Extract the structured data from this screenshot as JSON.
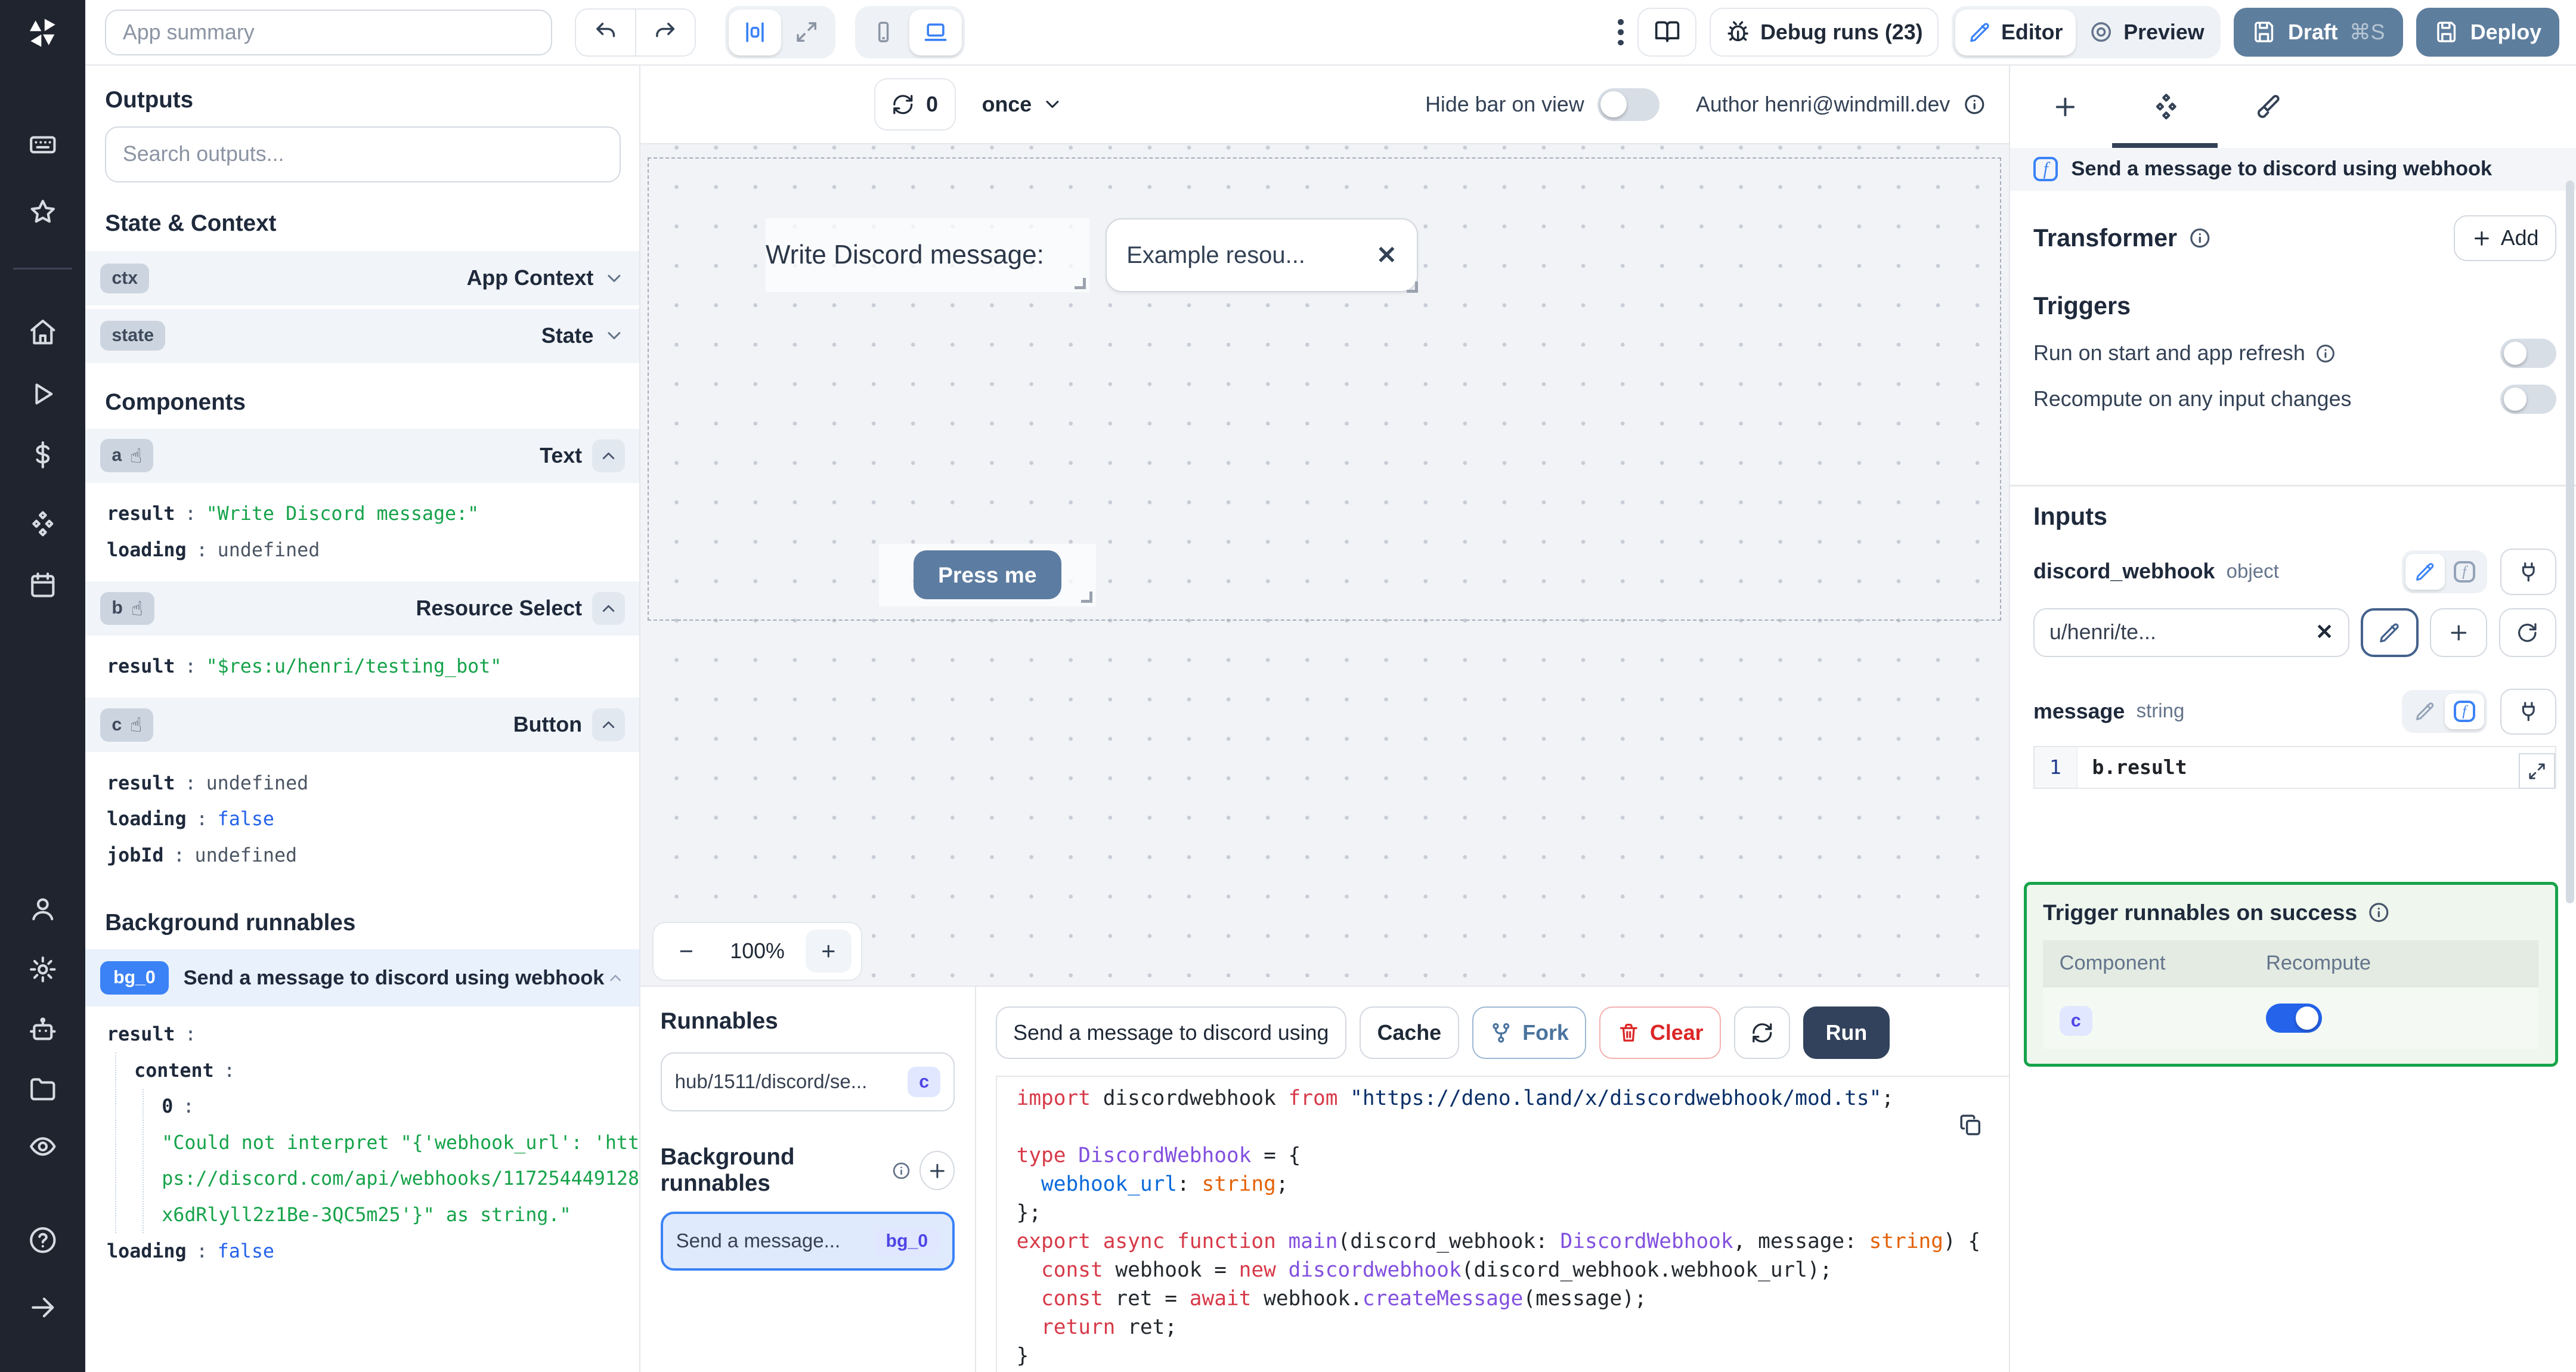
{
  "colors": {
    "accent_blue": "#3b82f6",
    "toggle_on": "#2563eb",
    "primary_button": "#5e7e9e",
    "run_button": "#32425c",
    "success_border": "#16a34a",
    "value_green": "#16a34a",
    "value_blue": "#2563eb",
    "rail_bg": "#1f242e"
  },
  "rail": {
    "icons_top": [
      "keyboard",
      "star",
      "home",
      "play",
      "dollar",
      "hub",
      "calendar"
    ],
    "icons_bottom": [
      "user",
      "gear",
      "robot",
      "folder",
      "eye",
      "help-circle",
      "arrow-right"
    ]
  },
  "topbar": {
    "app_summary_placeholder": "App summary",
    "debug_runs_label": "Debug runs (23)",
    "editor_label": "Editor",
    "preview_label": "Preview",
    "draft_label": "Draft",
    "draft_shortcut": "⌘S",
    "deploy_label": "Deploy"
  },
  "canvas_toolbar": {
    "refresh_count": "0",
    "schedule_mode": "once",
    "hide_bar_label": "Hide bar on view",
    "author_label": "Author henri@windmill.dev"
  },
  "canvas": {
    "text_component": "Write Discord message:",
    "select_value": "Example resou...",
    "button_label": "Press me",
    "zoom_out": "−",
    "zoom_level": "100%",
    "zoom_in": "+"
  },
  "outputs": {
    "title": "Outputs",
    "search_placeholder": "Search outputs...",
    "state_context_title": "State & Context",
    "ctx": {
      "badge": "ctx",
      "label": "App Context"
    },
    "state": {
      "badge": "state",
      "label": "State"
    },
    "components_title": "Components",
    "comp_a": {
      "badge": "a",
      "type": "Text",
      "rows": [
        {
          "k": "result",
          "v": "\"Write Discord message:\"",
          "c": "v-green"
        },
        {
          "k": "loading",
          "v": "undefined",
          "c": "v-gray"
        }
      ]
    },
    "comp_b": {
      "badge": "b",
      "type": "Resource Select",
      "rows": [
        {
          "k": "result",
          "v": "\"$res:u/henri/testing_bot\"",
          "c": "v-green"
        }
      ]
    },
    "comp_c": {
      "badge": "c",
      "type": "Button",
      "rows": [
        {
          "k": "result",
          "v": "undefined",
          "c": "v-gray"
        },
        {
          "k": "loading",
          "v": "false",
          "c": "v-blue"
        },
        {
          "k": "jobId",
          "v": "undefined",
          "c": "v-gray"
        }
      ]
    },
    "background_title": "Background runnables",
    "bg": {
      "badge": "bg_0",
      "title": "Send a message to discord using webhook",
      "k_result": "result",
      "k_content": "content",
      "k_zero": "0",
      "value": "\"Could not interpret \"{'webhook_url': 'https://discord.com/api/webhooks/117254449128x6dRlyll2z1Be-3QC5m25'}\" as string.\"",
      "k_loading": "loading",
      "v_loading": "false"
    }
  },
  "runnables": {
    "title": "Runnables",
    "item": {
      "label": "hub/1511/discord/se...",
      "badge": "c"
    },
    "background_title": "Background runnables",
    "selected": {
      "label": "Send a message...",
      "badge": "bg_0"
    }
  },
  "editor": {
    "tab_title": "Send a message to discord using",
    "cache_label": "Cache",
    "fork_label": "Fork",
    "clear_label": "Clear",
    "run_label": "Run",
    "code": [
      [
        {
          "t": "import ",
          "c": "tk-kw"
        },
        {
          "t": "discordwebhook ",
          "c": "tk-id"
        },
        {
          "t": "from ",
          "c": "tk-kw"
        },
        {
          "t": "\"https://deno.land/x/discordwebhook/mod.ts\"",
          "c": "tk-str"
        },
        {
          "t": ";",
          "c": "tk-pn"
        }
      ],
      [],
      [
        {
          "t": "type ",
          "c": "tk-kw"
        },
        {
          "t": "DiscordWebhook",
          "c": "tk-ty"
        },
        {
          "t": " = {",
          "c": "tk-pn"
        }
      ],
      [
        {
          "t": "  webhook_url",
          "c": "tk-pr"
        },
        {
          "t": ": ",
          "c": "tk-pn"
        },
        {
          "t": "string",
          "c": "tk-or"
        },
        {
          "t": ";",
          "c": "tk-pn"
        }
      ],
      [
        {
          "t": "};",
          "c": "tk-pn"
        }
      ],
      [
        {
          "t": "export ",
          "c": "tk-kw"
        },
        {
          "t": "async ",
          "c": "tk-kw"
        },
        {
          "t": "function ",
          "c": "tk-kw"
        },
        {
          "t": "main",
          "c": "tk-fn"
        },
        {
          "t": "(",
          "c": "tk-pn"
        },
        {
          "t": "discord_webhook",
          "c": "tk-id"
        },
        {
          "t": ": ",
          "c": "tk-pn"
        },
        {
          "t": "DiscordWebhook",
          "c": "tk-ty"
        },
        {
          "t": ", ",
          "c": "tk-pn"
        },
        {
          "t": "message",
          "c": "tk-id"
        },
        {
          "t": ": ",
          "c": "tk-pn"
        },
        {
          "t": "string",
          "c": "tk-or"
        },
        {
          "t": ") {",
          "c": "tk-pn"
        }
      ],
      [
        {
          "t": "  const ",
          "c": "tk-kw"
        },
        {
          "t": "webhook",
          "c": "tk-id"
        },
        {
          "t": " = ",
          "c": "tk-pn"
        },
        {
          "t": "new ",
          "c": "tk-kw"
        },
        {
          "t": "discordwebhook",
          "c": "tk-fn"
        },
        {
          "t": "(",
          "c": "tk-pn"
        },
        {
          "t": "discord_webhook",
          "c": "tk-id"
        },
        {
          "t": ".",
          "c": "tk-pn"
        },
        {
          "t": "webhook_url",
          "c": "tk-id"
        },
        {
          "t": ");",
          "c": "tk-pn"
        }
      ],
      [
        {
          "t": "  const ",
          "c": "tk-kw"
        },
        {
          "t": "ret",
          "c": "tk-id"
        },
        {
          "t": " = ",
          "c": "tk-pn"
        },
        {
          "t": "await ",
          "c": "tk-kw"
        },
        {
          "t": "webhook",
          "c": "tk-id"
        },
        {
          "t": ".",
          "c": "tk-pn"
        },
        {
          "t": "createMessage",
          "c": "tk-fn"
        },
        {
          "t": "(",
          "c": "tk-pn"
        },
        {
          "t": "message",
          "c": "tk-id"
        },
        {
          "t": ");",
          "c": "tk-pn"
        }
      ],
      [
        {
          "t": "  return ",
          "c": "tk-kw"
        },
        {
          "t": "ret",
          "c": "tk-id"
        },
        {
          "t": ";",
          "c": "tk-pn"
        }
      ],
      [
        {
          "t": "}",
          "c": "tk-pn"
        }
      ]
    ]
  },
  "right_panel": {
    "header_title": "Send a message to discord using webhook",
    "transformer_label": "Transformer",
    "add_label": "Add",
    "triggers_title": "Triggers",
    "trigger1": "Run on start and app refresh",
    "trigger2": "Recompute on any input changes",
    "inputs_title": "Inputs",
    "input1_name": "discord_webhook",
    "input1_type": "object",
    "resource_value": "u/henri/te...",
    "input2_name": "message",
    "input2_type": "string",
    "code_line_number": "1",
    "code_value": "b.result",
    "success_box": {
      "title": "Trigger runnables on success",
      "col_component": "Component",
      "col_recompute": "Recompute",
      "row_badge": "c"
    }
  }
}
